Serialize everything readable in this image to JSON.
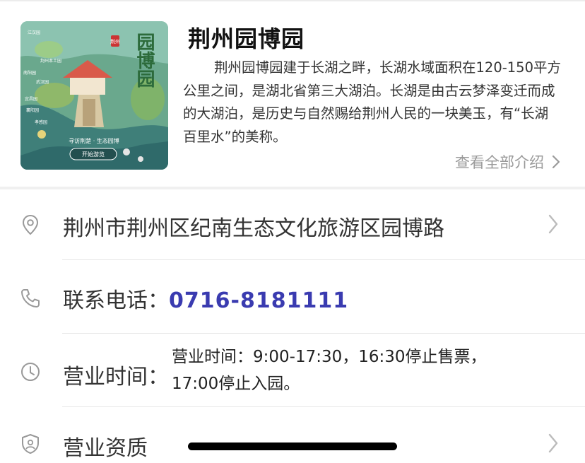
{
  "attraction": {
    "title": "荆州园博园",
    "description": "荆州园博园建于长湖之畔，长湖水域面积在120-150平方公里之间，是湖北省第三大湖泊。长湖是由古云梦泽变迁而成的大湖泊，是历史与自然赐给荆州人民的一块美玉，有“长湖百里水”的美称。",
    "more_label": "查看全部介绍"
  },
  "thumbnail": {
    "badge": "荆州",
    "big_text": "园博园",
    "slogan": "寻访荆楚 · 生态园博",
    "start_button": "开始游览",
    "map_labels": [
      "江汉园",
      "荆州本土园",
      "南阳园",
      "武汉园",
      "宜昌园",
      "襄阳园",
      "孝感园"
    ]
  },
  "address": {
    "text": "荆州市荆州区纪南生态文化旅游区园博路",
    "icon": "location-pin-icon"
  },
  "phone": {
    "label": "联系电话：",
    "number": "0716-8181111",
    "icon": "phone-icon"
  },
  "hours": {
    "label": "营业时间：",
    "value_line1": "营业时间：9:00-17:30，16:30停止售票，",
    "value_line2": "17:00停止入园。",
    "icon": "clock-icon"
  },
  "license": {
    "label": "营业资质",
    "icon": "shield-icon"
  },
  "colors": {
    "phone_accent": "#3a3bb0",
    "muted": "#9a9a9a",
    "divider": "#e6e6e6"
  }
}
